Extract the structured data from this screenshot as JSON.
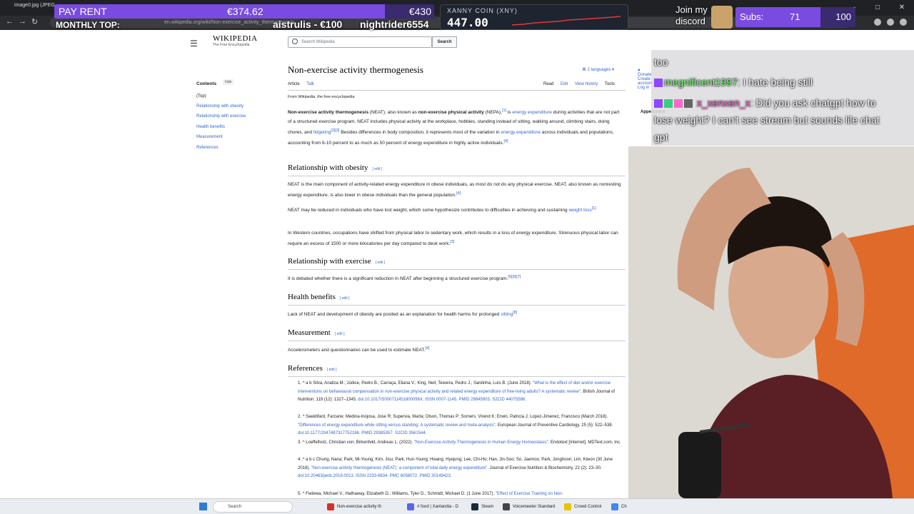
{
  "browser": {
    "first_tab_label": "image0.jpg (JPEG",
    "url": "en.wikipedia.org/wiki/Non-exercise_activity_thermogenesis",
    "window_controls": [
      "–",
      "□",
      "✕"
    ]
  },
  "overlay": {
    "pay_rent": {
      "label": "PAY RENT",
      "current": "€374.62",
      "goal": "€430",
      "progress": 0.87
    },
    "monthly_top": {
      "label": "MONTHLY TOP:",
      "first": "aistrulis - €100",
      "second": "nightrider6554"
    },
    "coin": {
      "name": "XANNY COIN (XNY)",
      "price": "447.00",
      "line_color": "#e03a3a"
    },
    "discord": {
      "line1": "Join my",
      "line2": "discord"
    },
    "subs": {
      "label": "Subs:",
      "current": "71",
      "goal": "100",
      "progress": 0.71
    }
  },
  "wiki": {
    "logo": {
      "title": "WIKIPEDIA",
      "subtitle": "The Free Encyclopedia"
    },
    "search": {
      "placeholder": "Search Wikipedia",
      "button": "Search"
    },
    "top_right": {
      "donate": "Donate",
      "account": "Create account",
      "login": "Log in"
    },
    "appearance": "Appearance",
    "toc": {
      "title": "Contents",
      "hide": "hide",
      "top": "(Top)",
      "items": [
        "Relationship with obesity",
        "Relationship with exercise",
        "Health benefits",
        "Measurement",
        "References"
      ]
    },
    "title": "Non-exercise activity thermogenesis",
    "languages": "2 languages",
    "tabs_left": [
      "Article",
      "Talk"
    ],
    "tabs_right": [
      "Read",
      "Edit",
      "View history",
      "Tools"
    ],
    "from": "From Wikipedia, the free encyclopedia",
    "intro": {
      "t1": "Non-exercise activity thermogenesis",
      "t2": " (NEAT), also known as ",
      "t3": "non-exercise physical activity",
      "t4": " (NEPA),",
      "sup1": "[1]",
      "t5": " is ",
      "link1": "energy expenditure",
      "t6": " during activities that are not part of a structured exercise program. NEAT includes physical activity at the workplace, hobbies, standing instead of sitting, walking around, climbing stairs, doing chores, and ",
      "link2": "fidgeting",
      "sup2": "[2][3]",
      "t7": " Besides differences in body composition, it represents most of the variation in ",
      "link3": "energy expenditure",
      "t8": " across individuals and populations, accounting from 6-10 percent to as much as 50 percent of energy expenditure in highly active individuals.",
      "sup3": "[4]"
    },
    "edit_label": "edit",
    "sections": {
      "obesity": {
        "heading": "Relationship with obesity",
        "p1": "NEAT is the main component of activity-related energy expenditure in obese individuals, as most do not do any physical exercise. NEAT, also known as nonresting energy expenditure, is also lower in obese individuals than the general population.",
        "p1_sup": "[4]",
        "p2": "NEAT may be reduced in individuals who have lost weight, which some hypothesize contributes to difficulties in achieving and sustaining ",
        "p2_link": "weight loss",
        "p2_sup": "[1]",
        "p3": "In Western countries, occupations have shifted from physical labor to sedentary work, which results in a loss of energy expenditure. Strenuous physical labor can require an excess of 1500 or more kilocalories per day compared to desk work.",
        "p3_sup": "[3]"
      },
      "exercise": {
        "heading": "Relationship with exercise",
        "p1": "It is debated whether there is a significant reduction in NEAT after beginning a structured exercise program.",
        "p1_sup": "[5][6][7]"
      },
      "health": {
        "heading": "Health benefits",
        "p1": "Lack of NEAT and development of obesity are posited as an explanation for health harms for prolonged ",
        "p1_link": "sitting",
        "p1_sup": "[8]"
      },
      "measurement": {
        "heading": "Measurement",
        "p1": "Accelerometers and questionnaires can be used to estimate NEAT.",
        "p1_sup": "[4]"
      },
      "references": {
        "heading": "References",
        "items": [
          {
            "num": "1.",
            "a": "^ a b Silva, Analiza M.; Júdice, Pedro B.; Carraça, Eliana V.; King, Neil; Teixeira, Pedro J.; Sardinha, Luís B. (June 2018). ",
            "link": "\"What is the effect of diet and/or exercise interventions on behavioural compensation in non-exercise physical activity and related energy expenditure of free-living adults? A systematic review\"",
            "b": ". British Journal of Nutrition. 119 (12): 1327–1345. ",
            "ids": "doi:10.1017/S000711451800096X. ISSN 0007-1145. PMID 29845903. S2CID 44075586."
          },
          {
            "num": "2.",
            "a": "^ Saeidifard, Farzane; Medina-Inojosa, Jose R; Supervia, Marta; Olson, Thomas P; Somers, Virend K; Erwin, Patricia J; Lopez-Jimenez, Francisco (March 2018). ",
            "link": "\"Differences of energy expenditure while sitting versus standing: A systematic review and meta-analysis\"",
            "b": ". European Journal of Preventive Cardiology. 25 (5): 522–538. ",
            "ids": "doi:10.1177/2047487317752186. PMID 29385357. S2CID 3561544."
          },
          {
            "num": "3.",
            "a": "^ Loeffelholz, Christian von; Birkenfeld, Andreas L. (2022). ",
            "link": "\"Non-Exercise Activity Thermogenesis in Human Energy Homeostasis\"",
            "b": ". Endotext [Internet]. MDText.com, Inc.",
            "ids": ""
          },
          {
            "num": "4.",
            "a": "^ a b c Chung, Nana; Park, Mi-Young; Kim, Jisu; Park, Hun-Young; Hwang, Hyejung; Lee, Chi-Ho; Han, Jin-Soo; So, Jaemoo; Park, Jonghoon; Lim, Kiwon (30 June 2018). ",
            "link": "\"Non-exercise activity thermogenesis (NEAT): a component of total daily energy expenditure\"",
            "b": ". Journal of Exercise Nutrition & Biochemistry. 22 (2): 23–30. ",
            "ids": "doi:10.20463/jenb.2018.0013. ISSN 2233-6834. PMC 6058072. PMID 30149423."
          },
          {
            "num": "5.",
            "a": "^ Fedewa, Michael V.; Hathaway, Elizabeth D.; Williams, Tyler D.; Schmidt, Michael D. (1 June 2017). ",
            "link": "\"Effect of Exercise Training on Non-",
            "b": "",
            "ids": ""
          }
        ]
      }
    }
  },
  "chat": {
    "line0": "too",
    "msg1": {
      "user": "megnificent1997",
      "text": ": I hate being still"
    },
    "msg2": {
      "user": "x_xenxen_x",
      "text": ": Did you ask chatgpt how to",
      "cont1": "lose weight? I can't see stream but sounds lile chat",
      "cont2": "gpt"
    }
  },
  "taskbar": {
    "search": "Search",
    "items": [
      {
        "label": "Non-exercise activity th",
        "color": "#d93025"
      },
      {
        "label": "# food | Xanlandia - D",
        "color": "#5865f2"
      },
      {
        "label": "Steam",
        "color": "#1b2838"
      },
      {
        "label": "Voicemeeter Standard",
        "color": "#444444"
      },
      {
        "label": "Crowd Control",
        "color": "#e8c300"
      },
      {
        "label": "Ch",
        "color": "#4285f4"
      }
    ]
  }
}
